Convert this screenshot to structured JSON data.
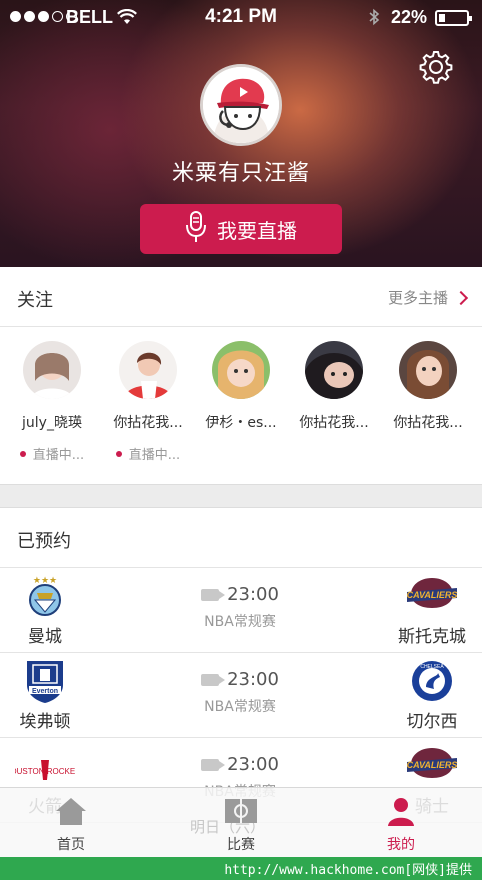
{
  "status_bar": {
    "carrier": "BELL",
    "time": "4:21 PM",
    "battery": "22%",
    "battery_level": 0.22
  },
  "profile": {
    "username": "米粟有只汪酱",
    "live_button": "我要直播",
    "settings_icon": "gear-icon"
  },
  "follow": {
    "title": "关注",
    "more": "更多主播",
    "anchors": [
      {
        "name": "july_晓瑛",
        "status": "直播中...",
        "live": true
      },
      {
        "name": "你拈花我...",
        "status": "直播中...",
        "live": true
      },
      {
        "name": "伊杉・es...",
        "status": "",
        "live": false
      },
      {
        "name": "你拈花我...",
        "status": "",
        "live": false
      },
      {
        "name": "你拈花我...",
        "status": "",
        "live": false
      }
    ]
  },
  "booked": {
    "title": "已预约",
    "matches": [
      {
        "home": "曼城",
        "away": "斯托克城",
        "time": "23:00",
        "type": "NBA常规赛"
      },
      {
        "home": "埃弗顿",
        "away": "切尔西",
        "time": "23:00",
        "type": "NBA常规赛"
      },
      {
        "home": "火箭",
        "away": "骑士",
        "time": "23:00",
        "type": "NBA常规赛"
      }
    ],
    "partial_date": "明日（六）"
  },
  "tabbar": {
    "tabs": [
      {
        "label": "首页",
        "icon": "home-icon"
      },
      {
        "label": "比赛",
        "icon": "soccer-field-icon"
      },
      {
        "label": "我的",
        "icon": "user-icon",
        "active": true
      }
    ]
  },
  "watermark": "http://www.hackhome.com[网侠]提供",
  "colors": {
    "accent": "#cc1c4e",
    "footer": "#2fa84f"
  }
}
